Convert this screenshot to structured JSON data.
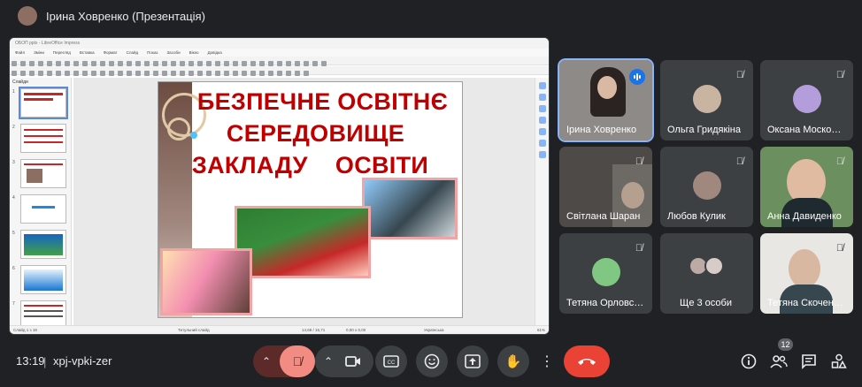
{
  "header": {
    "presenter_title": "Ірина Ховренко (Презентація)"
  },
  "presentation": {
    "window_title": "ОБОП pptx - LibreOffice Impress",
    "menu": [
      "Файл",
      "Зміни",
      "Перегляд",
      "Вставка",
      "Формат",
      "Слайд",
      "Показ",
      "Засоби",
      "Вікно",
      "Довідка"
    ],
    "slides_pane_title": "Слайди",
    "slide_numbers": [
      "1",
      "2",
      "3",
      "4",
      "5",
      "6",
      "7"
    ],
    "slide_title_lines": [
      "БЕЗПЕЧНЕ ОСВІТНЄ",
      "СЕРЕДОВИЩЕ",
      "ЗАКЛАДУ    ОСВІТИ"
    ],
    "status": {
      "slide_info": "Слайд 1 з 18",
      "layout": "Титульний слайд",
      "position": "14,68 / 15,71",
      "size": "0,00 x 0,00",
      "language": "Українська",
      "zoom": "61%"
    }
  },
  "participants": [
    {
      "name": "Ірина Ховренко",
      "speaking": true,
      "video": true
    },
    {
      "name": "Ольга Гридякіна",
      "muted": true
    },
    {
      "name": "Оксана Моско…",
      "muted": true
    },
    {
      "name": "Світлана Шаран",
      "muted": true,
      "video": true
    },
    {
      "name": "Любов Кулик",
      "muted": true
    },
    {
      "name": "Анна Давиденко",
      "muted": true,
      "video": true
    },
    {
      "name": "Тетяна Орловс…",
      "muted": true
    },
    {
      "name": "Ще 3 особи"
    },
    {
      "name": "Тетяна Скочен…",
      "muted": true,
      "video": true
    }
  ],
  "footer": {
    "time": "13:19",
    "separator": "|",
    "meeting_code": "xpj-vpki-zer",
    "people_count": "12"
  },
  "icons": {
    "mic_off": "mic-off-icon",
    "camera": "camera-icon",
    "captions": "captions-icon",
    "emoji": "emoji-icon",
    "present": "present-icon",
    "hand": "raise-hand-icon",
    "more": "more-vert-icon",
    "hangup": "hangup-icon",
    "info": "info-icon",
    "people": "people-icon",
    "chat": "chat-icon",
    "activities": "activities-icon"
  },
  "colors": {
    "hangup": "#ea4335",
    "slide_title": "#c00000",
    "speaking": "#1a73e8"
  }
}
